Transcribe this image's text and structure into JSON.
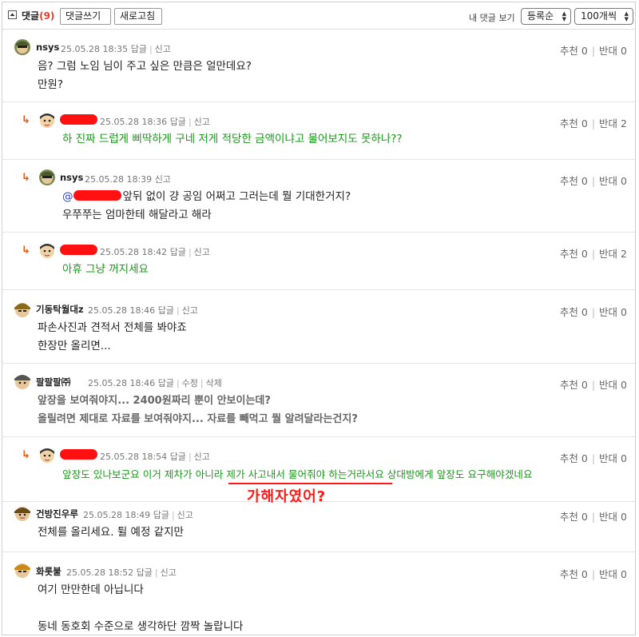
{
  "header": {
    "title": "댓글",
    "count": "(9)",
    "write_button": "댓글쓰기",
    "refresh_button": "새로고침",
    "my_comments": "내 댓글 보기",
    "sort_select": "등록순",
    "count_select": "100개씩"
  },
  "labels": {
    "reply": "답글",
    "report": "신고",
    "edit": "수정",
    "delete": "삭제",
    "up": "추천",
    "down": "반대"
  },
  "comments": [
    {
      "nick": "nsys",
      "date": "25.05.28 18:35",
      "up": "0",
      "down": "0",
      "lines": [
        "음? 그럼 노임 님이 주고 싶은 만큼은 얼만데요?",
        "만원?"
      ]
    },
    {
      "nick": "",
      "date": "25.05.28 18:36",
      "up": "0",
      "down": "2",
      "lines": [
        "하 진짜 드럽게 삐딱하게 구네 저게 적당한 금액이냐고 물어보지도 못하나??"
      ]
    },
    {
      "nick": "nsys",
      "date": "25.05.28 18:39",
      "up": "0",
      "down": "0",
      "mention": "@",
      "lines": [
        "앞뒤 없이 걍 공임 어쩌고 그러는데 뭘 기대한거지?",
        "우쭈쭈는 엄마한테 해달라고 해라"
      ]
    },
    {
      "nick": "",
      "date": "25.05.28 18:42",
      "up": "0",
      "down": "2",
      "lines": [
        "아휴 그냥 꺼지세요"
      ]
    },
    {
      "nick": "기동탁월대z",
      "date": "25.05.28 18:46",
      "up": "0",
      "down": "0",
      "lines": [
        "파손사진과 견적서 전체를 봐야죠",
        "한장만 올리면..."
      ]
    },
    {
      "nick": "팔팔팔㈜",
      "date": "25.05.28 18:46",
      "up": "0",
      "down": "0",
      "lines": [
        "앞장을 보여줘야지... 2400원짜리 뿐이 안보이는데?",
        "올릴려면 제대로 자료를 보여줘야지... 자료를 빼먹고 뭘 알려달라는건지?"
      ]
    },
    {
      "nick": "",
      "date": "25.05.28 18:54",
      "up": "0",
      "down": "0",
      "lines": [
        "앞장도 있나보군요 이거 제차가 아니라 제가 사고내서 물어줘야 하는거라서요 상대방에게 앞장도 요구해야겠네요"
      ]
    },
    {
      "nick": "건방진우루",
      "date": "25.05.28 18:49",
      "up": "0",
      "down": "0",
      "lines": [
        "전체를 올리세요. 튈 예정 같지만"
      ]
    },
    {
      "nick": "화롯불",
      "date": "25.05.28 18:52",
      "up": "0",
      "down": "0",
      "lines": [
        "여기 만만한데 아닙니다",
        "",
        "동네 동호회 수준으로 생각하단 깜짝 놀랍니다"
      ]
    }
  ],
  "annotation": "가해자였어?",
  "colors": {
    "accent": "#e0412b",
    "green": "#1a9a1a",
    "redact": "#ff1111",
    "mention": "#2a3fcf"
  }
}
